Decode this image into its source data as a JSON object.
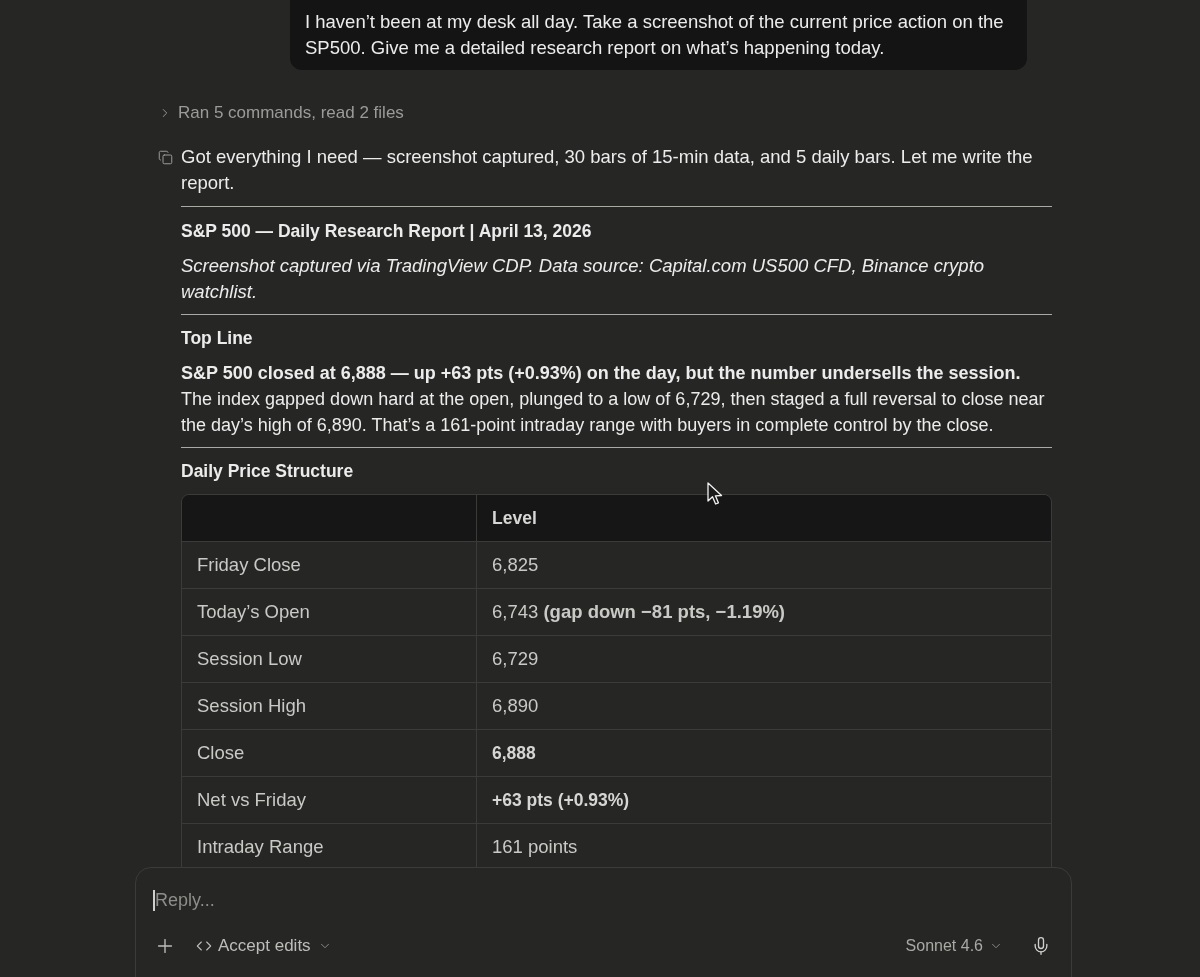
{
  "user_message": {
    "text": "I haven’t been at my desk all day. Take a screenshot of the current price action on the SP500. Give me a detailed research report on what’s happening today."
  },
  "tool_summary": {
    "label": "Ran 5 commands, read 2 files",
    "expanded": false
  },
  "assistant_message": {
    "intro": "Got everything I need — screenshot captured, 30 bars of 15-min data, and 5 daily bars. Let me write the report.",
    "report": {
      "title": "S&P 500 — Daily Research Report | April 13, 2026",
      "source_note": "Screenshot captured via TradingView CDP. Data source: Capital.com US500 CFD, Binance crypto watchlist.",
      "sections": [
        {
          "kind": "text",
          "heading": "Top Line",
          "paragraph": "**S&P 500 closed at 6,888 — up +63 pts (+0.93%) on the day, but the number undersells the session.** The index gapped down hard at the open, plunged to a low of 6,729, then staged a full reversal to close near the day’s high of 6,890. That’s a 161-point intraday range with buyers in complete control by the close."
        },
        {
          "kind": "table",
          "heading": "Daily Price Structure",
          "table": {
            "value_header": "Level",
            "rows": [
              {
                "label": "Friday Close",
                "value": "6,825",
                "bold": false
              },
              {
                "label": "Today’s Open",
                "value": "6,743 **(gap down −81 pts, −1.19%)**",
                "bold": false
              },
              {
                "label": "Session Low",
                "value": "6,729",
                "bold": false
              },
              {
                "label": "Session High",
                "value": "6,890",
                "bold": false
              },
              {
                "label": "Close",
                "value": "6,888",
                "bold": true
              },
              {
                "label": "Net vs Friday",
                "value": "+63 pts (+0.93%)",
                "bold": true
              },
              {
                "label": "Intraday Range",
                "value": "161 points",
                "bold": false
              }
            ]
          }
        }
      ]
    }
  },
  "composer": {
    "placeholder": "Reply...",
    "focused": true,
    "mode": "Accept edits",
    "model": "Sonnet 4.6"
  }
}
